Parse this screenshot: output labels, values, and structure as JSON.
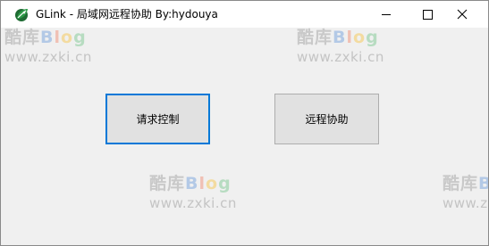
{
  "window": {
    "title": "GLink - 局域网远程协助 By:hydouya",
    "controls": {
      "minimize_icon": "minimize-icon",
      "maximize_icon": "maximize-icon",
      "close_icon": "close-icon"
    }
  },
  "buttons": {
    "request_control": "请求控制",
    "remote_assist": "远程协助"
  },
  "watermark": {
    "logo_cjk": "酷库",
    "logo_b": "B",
    "logo_l": "l",
    "logo_o": "o",
    "logo_g": "g",
    "url": "www.zxki.cn"
  },
  "colors": {
    "focus_border": "#0078d7",
    "button_face": "#e1e1e1",
    "window_bg": "#f0f0f0"
  }
}
